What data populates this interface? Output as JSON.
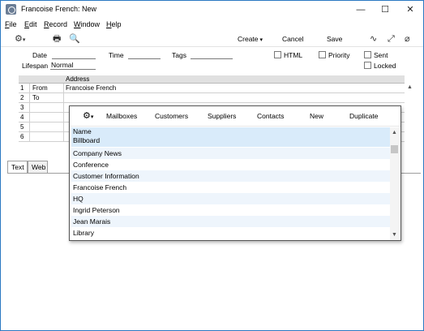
{
  "window": {
    "title": "Francoise French: New",
    "buttons": {
      "minimize": "—",
      "maximize": "☐",
      "close": "✕"
    }
  },
  "menubar": {
    "items": [
      {
        "pre": "",
        "u": "F",
        "post": "ile"
      },
      {
        "pre": "",
        "u": "E",
        "post": "dit"
      },
      {
        "pre": "",
        "u": "R",
        "post": "ecord"
      },
      {
        "pre": "",
        "u": "W",
        "post": "indow"
      },
      {
        "pre": "",
        "u": "H",
        "post": "elp"
      }
    ]
  },
  "toolbar": {
    "create": "Create",
    "cancel": "Cancel",
    "save": "Save"
  },
  "form": {
    "date_label": "Date",
    "date_value": "",
    "time_label": "Time",
    "time_value": "",
    "tags_label": "Tags",
    "tags_value": "",
    "lifespan_label": "Lifespan",
    "lifespan_value": "Normal",
    "html_label": "HTML",
    "priority_label": "Priority",
    "sent_label": "Sent",
    "locked_label": "Locked"
  },
  "grid": {
    "header": "Address",
    "rows": [
      {
        "n": "1",
        "type": "From",
        "address": "Francoise French"
      },
      {
        "n": "2",
        "type": "To",
        "address": ""
      },
      {
        "n": "3",
        "type": "",
        "address": ""
      },
      {
        "n": "4",
        "type": "",
        "address": ""
      },
      {
        "n": "5",
        "type": "",
        "address": ""
      },
      {
        "n": "6",
        "type": "",
        "address": ""
      }
    ]
  },
  "tabs": {
    "text": "Text",
    "web": "Web"
  },
  "popup": {
    "toolbar": [
      "Mailboxes",
      "Customers",
      "Suppliers",
      "Contacts",
      "New",
      "Duplicate"
    ],
    "list_header": "Name",
    "selected": "Billboard",
    "items": [
      "Company News",
      "Conference",
      "Customer Information",
      "Francoise French",
      "HQ",
      "Ingrid Peterson",
      "Jean Marais",
      "Library"
    ]
  }
}
